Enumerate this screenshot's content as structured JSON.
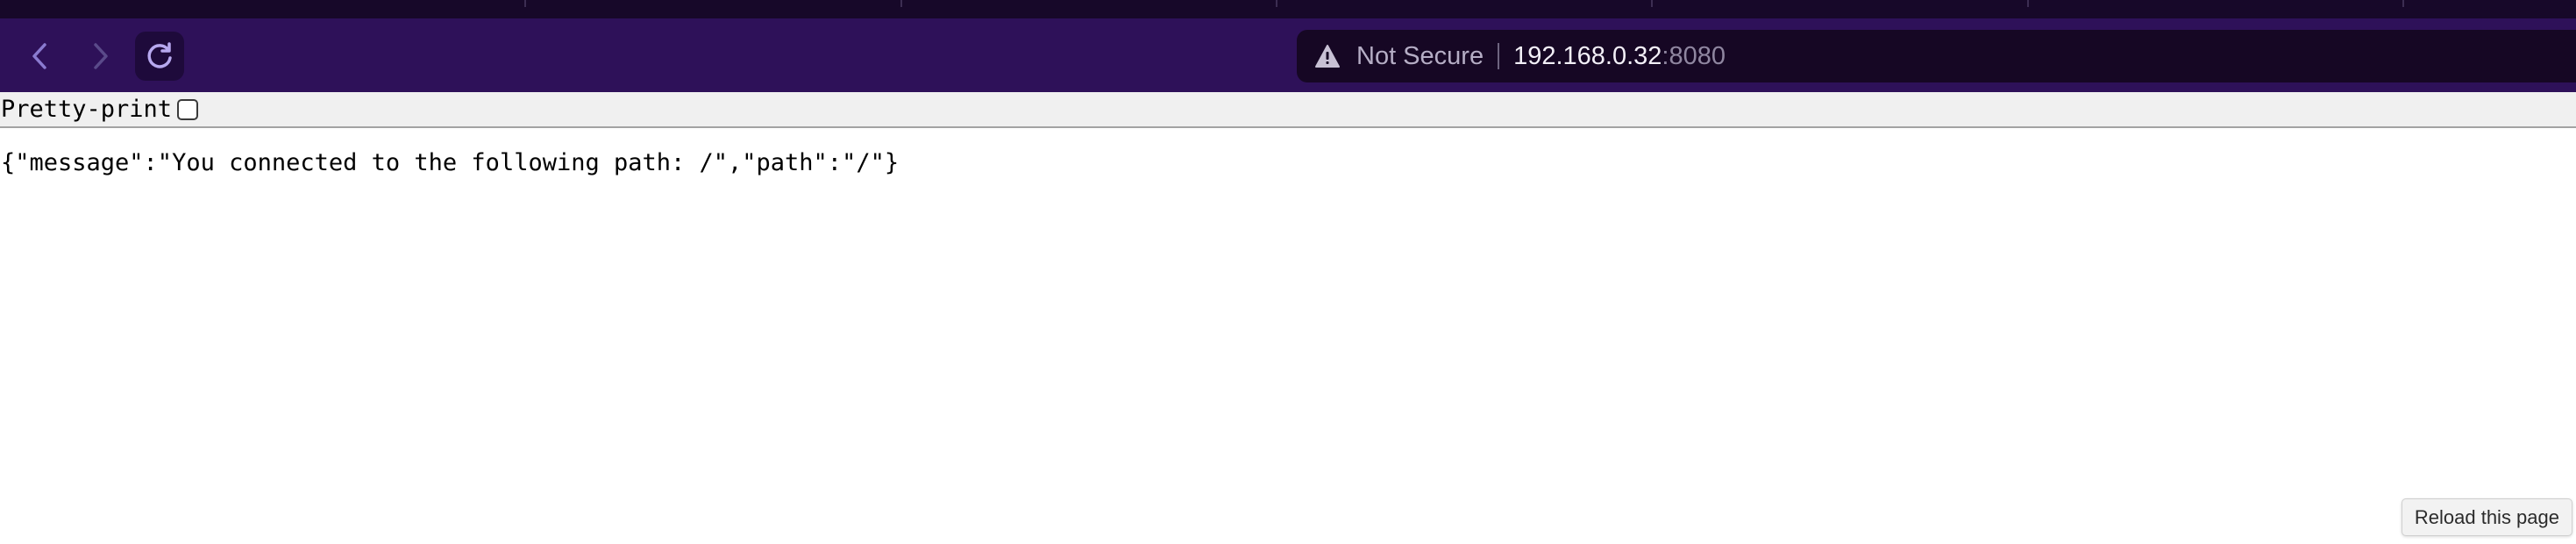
{
  "browser": {
    "colors": {
      "tabstrip": "#170829",
      "toolbar": "#2e1159",
      "urlbar": "#160724"
    },
    "nav": {
      "back_icon": "chevron-left",
      "forward_icon": "chevron-right",
      "reload_icon": "reload"
    },
    "urlbar": {
      "security_icon": "warning-triangle",
      "security_text": "Not Secure",
      "host": "192.168.0.32",
      "port": ":8080"
    }
  },
  "json_viewer": {
    "pretty_print_label": "Pretty-print",
    "pretty_print_checked": false,
    "raw_text": "{\"message\":\"You connected to the following path: /\",\"path\":\"/\"}"
  },
  "tooltip": {
    "text": "Reload this page"
  }
}
